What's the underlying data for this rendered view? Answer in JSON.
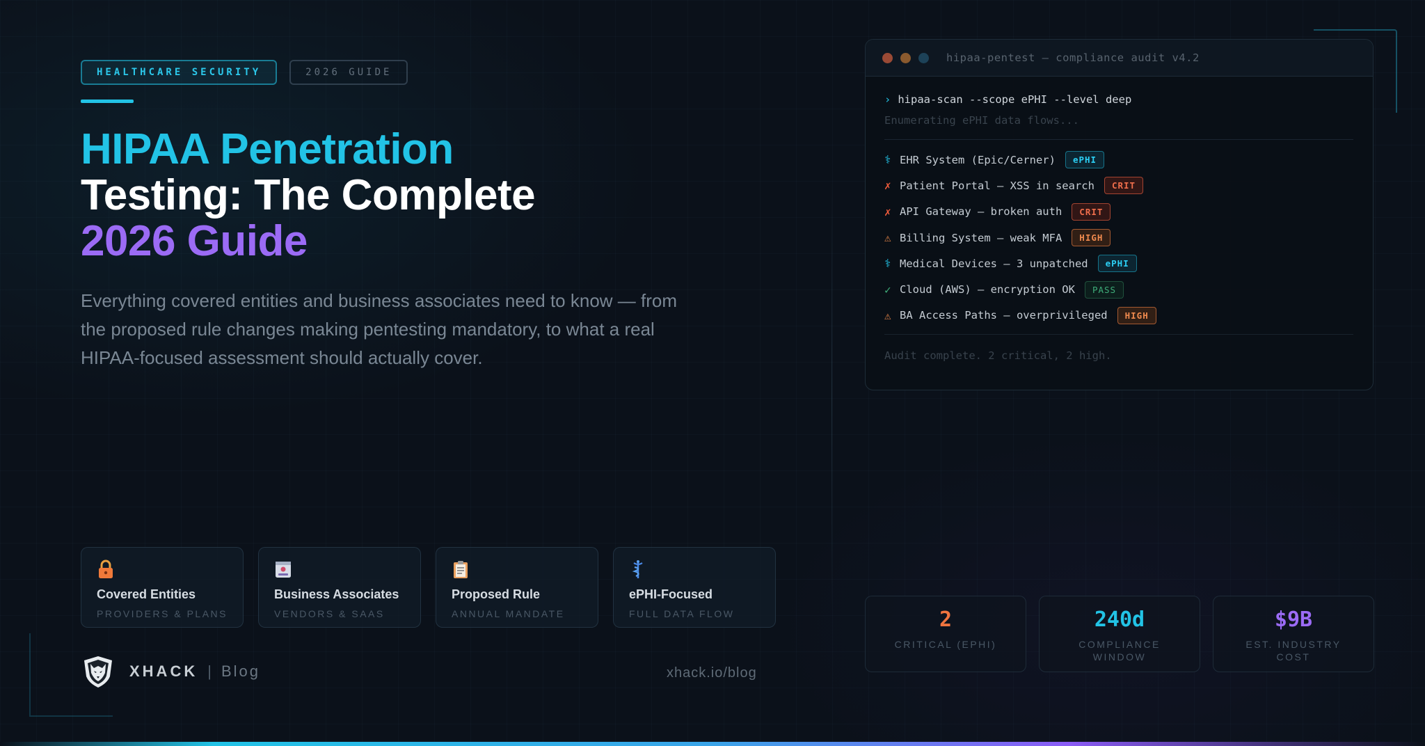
{
  "tags": {
    "primary": "HEALTHCARE SECURITY",
    "secondary": "2026 GUIDE"
  },
  "hero": {
    "title_line1": "HIPAA Penetration",
    "title_line2": "Testing: The Complete",
    "title_line3": "2026 Guide",
    "subtitle": "Everything covered entities and business associates need to know — from the proposed rule changes making pentesting mandatory, to what a real HIPAA-focused assessment should actually cover."
  },
  "cards": [
    {
      "icon": "lock-icon",
      "title": "Covered Entities",
      "subtitle": "PROVIDERS & PLANS"
    },
    {
      "icon": "id-badge-icon",
      "title": "Business Associates",
      "subtitle": "VENDORS & SAAS"
    },
    {
      "icon": "clipboard-icon",
      "title": "Proposed Rule",
      "subtitle": "ANNUAL MANDATE"
    },
    {
      "icon": "caduceus-icon",
      "title": "ePHI-Focused",
      "subtitle": "FULL DATA FLOW"
    }
  ],
  "brand": {
    "name": "XHACK",
    "separator": "|",
    "section": "Blog",
    "url": "xhack.io/blog"
  },
  "terminal": {
    "title": "hipaa-pentest — compliance audit v4.2",
    "prompt": "›",
    "command": "hipaa-scan --scope ePHI --level deep",
    "status": "Enumerating ePHI data flows...",
    "rows": [
      {
        "icon": "⚕",
        "text": "EHR System (Epic/Cerner)",
        "badge": "ePHI"
      },
      {
        "icon": "✗",
        "text": "Patient Portal — XSS in search",
        "badge": "CRIT"
      },
      {
        "icon": "✗",
        "text": "API Gateway — broken auth",
        "badge": "CRIT"
      },
      {
        "icon": "⚠",
        "text": "Billing System — weak MFA",
        "badge": "HIGH"
      },
      {
        "icon": "⚕",
        "text": "Medical Devices — 3 unpatched",
        "badge": "ePHI"
      },
      {
        "icon": "✓",
        "text": "Cloud (AWS) — encryption OK",
        "badge": "PASS"
      },
      {
        "icon": "⚠",
        "text": "BA Access Paths — overprivileged",
        "badge": "HIGH"
      }
    ],
    "footer": "Audit complete. 2 critical, 2 high."
  },
  "stats": [
    {
      "value": "2",
      "label": "CRITICAL (EPHI)"
    },
    {
      "value": "240d",
      "label": "COMPLIANCE WINDOW"
    },
    {
      "value": "$9B",
      "label": "EST. INDUSTRY COST"
    }
  ],
  "colors": {
    "background": "#0b111a",
    "cyan": "#22c3e6",
    "purple": "#9b6bf5",
    "critical": "#ef5b3b",
    "high": "#f08a4e",
    "pass": "#3fae7a"
  }
}
